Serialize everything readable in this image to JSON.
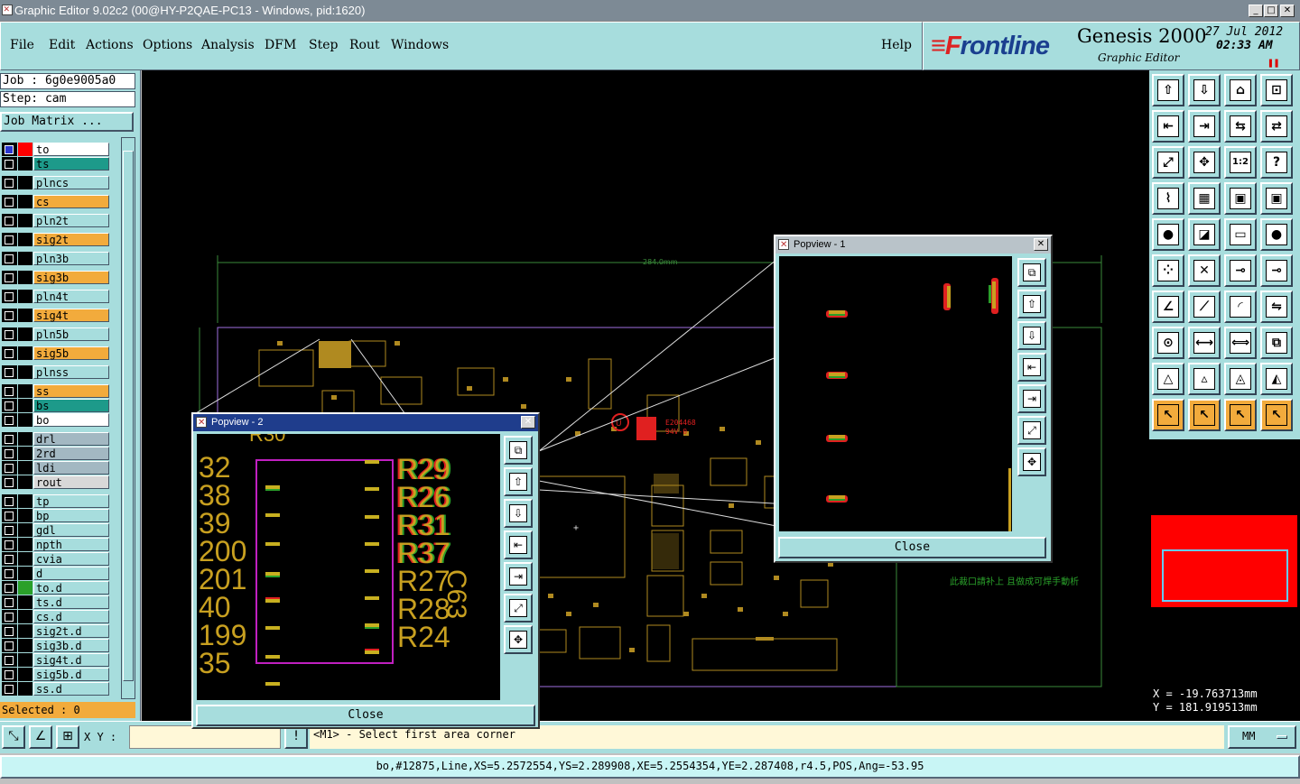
{
  "window": {
    "title": "Graphic Editor 9.02c2 (00@HY-P2QAE-PC13 - Windows, pid:1620)",
    "controls": [
      "_",
      "□",
      "✕"
    ]
  },
  "menu": {
    "items": [
      "File",
      "Edit",
      "Actions",
      "Options",
      "Analysis",
      "DFM",
      "Step",
      "Rout",
      "Windows"
    ],
    "help": "Help"
  },
  "logo": {
    "brand": "Frontline",
    "product": "Genesis 2000",
    "subtitle": "Graphic Editor",
    "date": "27  Jul  2012",
    "time": "02:33  AM"
  },
  "left_panel": {
    "job_label": "Job : 6g0e9005a0",
    "step_label": "Step: cam",
    "job_matrix": "Job Matrix ...",
    "layers": [
      {
        "name": "to",
        "color": "#ffffff",
        "swatch": "#ff0000",
        "selected": true
      },
      {
        "name": "ts",
        "color": "#1d9a8a",
        "swatch": "#000000"
      },
      {
        "name": "plncs",
        "color": "#a7dddd",
        "swatch": "#000000"
      },
      {
        "name": "cs",
        "color": "#f2ab3c",
        "swatch": "#000000"
      },
      {
        "name": "pln2t",
        "color": "#a7dddd",
        "swatch": "#000000"
      },
      {
        "name": "sig2t",
        "color": "#f2ab3c",
        "swatch": "#000000"
      },
      {
        "name": "pln3b",
        "color": "#a7dddd",
        "swatch": "#000000"
      },
      {
        "name": "sig3b",
        "color": "#f2ab3c",
        "swatch": "#000000"
      },
      {
        "name": "pln4t",
        "color": "#a7dddd",
        "swatch": "#000000"
      },
      {
        "name": "sig4t",
        "color": "#f2ab3c",
        "swatch": "#000000"
      },
      {
        "name": "pln5b",
        "color": "#a7dddd",
        "swatch": "#000000"
      },
      {
        "name": "sig5b",
        "color": "#f2ab3c",
        "swatch": "#000000"
      },
      {
        "name": "plnss",
        "color": "#a7dddd",
        "swatch": "#000000"
      },
      {
        "name": "ss",
        "color": "#f2ab3c",
        "swatch": "#000000"
      },
      {
        "name": "bs",
        "color": "#1d9a8a",
        "swatch": "#000000"
      },
      {
        "name": "bo",
        "color": "#ffffff",
        "swatch": "#000000"
      },
      {
        "name": "drl",
        "color": "#a3b8c2",
        "swatch": "#000000"
      },
      {
        "name": "2rd",
        "color": "#a3b8c2",
        "swatch": "#000000"
      },
      {
        "name": "ldi",
        "color": "#a3b8c2",
        "swatch": "#000000"
      },
      {
        "name": "rout",
        "color": "#d8d8d8",
        "swatch": "#000000"
      },
      {
        "name": "tp",
        "color": "#a7dddd",
        "swatch": "#000000"
      },
      {
        "name": "bp",
        "color": "#a7dddd",
        "swatch": "#000000"
      },
      {
        "name": "gdl",
        "color": "#a7dddd",
        "swatch": "#000000"
      },
      {
        "name": "npth",
        "color": "#a7dddd",
        "swatch": "#000000"
      },
      {
        "name": "cvia",
        "color": "#a7dddd",
        "swatch": "#000000"
      },
      {
        "name": "d",
        "color": "#a7dddd",
        "swatch": "#000000"
      },
      {
        "name": "to.d",
        "color": "#a7dddd",
        "swatch": "#2aa02a"
      },
      {
        "name": "ts.d",
        "color": "#a7dddd",
        "swatch": "#000000"
      },
      {
        "name": "cs.d",
        "color": "#a7dddd",
        "swatch": "#000000"
      },
      {
        "name": "sig2t.d",
        "color": "#a7dddd",
        "swatch": "#000000"
      },
      {
        "name": "sig3b.d",
        "color": "#a7dddd",
        "swatch": "#000000"
      },
      {
        "name": "sig4t.d",
        "color": "#a7dddd",
        "swatch": "#000000"
      },
      {
        "name": "sig5b.d",
        "color": "#a7dddd",
        "swatch": "#000000"
      },
      {
        "name": "ss.d",
        "color": "#a7dddd",
        "swatch": "#000000"
      }
    ],
    "selected_label": "Selected : 0"
  },
  "canvas": {
    "dimension_label": "284.0mm",
    "chinese_note": "此裁口請补上 且做成可焊手動析",
    "ul_mark": "E204468",
    "ul_grade": "94V-0"
  },
  "popview2": {
    "title": "Popview - 2",
    "left_labels": [
      "R30",
      "32",
      "38",
      "39",
      "200",
      "201",
      "40",
      "199",
      "35"
    ],
    "right_labels": [
      "R29",
      "R26",
      "R31",
      "R37",
      "R27",
      "R28",
      "R24"
    ],
    "side_label": "C63",
    "close": "Close"
  },
  "popview1": {
    "title": "Popview - 1",
    "close": "Close"
  },
  "coords": {
    "x": "X =  -19.763713mm",
    "y": "Y =  181.919513mm"
  },
  "bottom": {
    "xy_label": "X Y :",
    "xy_value": "",
    "excl": "!",
    "prompt": "<M1> - Select first area corner",
    "units": "MM"
  },
  "status": {
    "text": "bo,#12875,Line,XS=5.2572554,YS=2.289908,XE=5.2554354,YE=2.287408,r4.5,POS,Ang=-53.95"
  },
  "toolbar_icons": [
    "home-up-icon",
    "home-down-icon",
    "house-icon",
    "xy-frame-icon",
    "pan-left-icon",
    "pan-right-icon",
    "mirror-icon",
    "switch-icon",
    "zoom-fit-icon",
    "zoom-full-icon",
    "scale-1-2-icon",
    "help-icon",
    "brush-icon",
    "grid-icon",
    "layers-red-icon",
    "layers-red-blue-icon",
    "pad-icon",
    "color-icon",
    "ruler-icon",
    "dot-icon",
    "connect-icon",
    "cross-icon",
    "snap-icon",
    "snap-arrow-icon",
    "angle-icon",
    "line-icon",
    "arc-icon",
    "flip-icon",
    "point-icon",
    "line-move-icon",
    "resize-icon",
    "align-icon",
    "triangle-icon",
    "triangle-arrow-icon",
    "triangle-arc-icon",
    "triangle-wave-icon",
    "select-icon",
    "select-rect-icon",
    "select-circle-icon",
    "select-net-icon"
  ]
}
